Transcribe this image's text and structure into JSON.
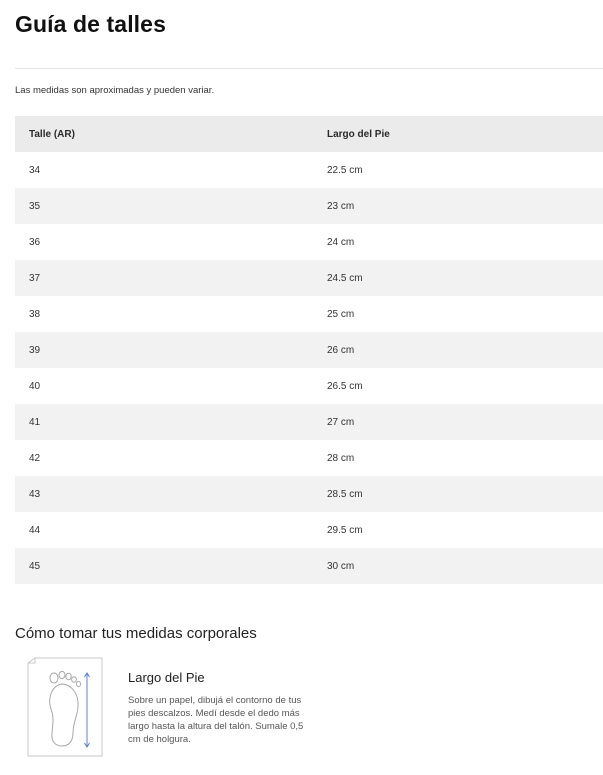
{
  "page": {
    "title": "Guía de talles",
    "disclaimer": "Las medidas son aproximadas y pueden variar."
  },
  "size_table": {
    "headers": {
      "size": "Talle (AR)",
      "foot_length": "Largo del Pie"
    },
    "rows": [
      {
        "size": "34",
        "foot_length": "22.5 cm"
      },
      {
        "size": "35",
        "foot_length": "23 cm"
      },
      {
        "size": "36",
        "foot_length": "24 cm"
      },
      {
        "size": "37",
        "foot_length": "24.5 cm"
      },
      {
        "size": "38",
        "foot_length": "25 cm"
      },
      {
        "size": "39",
        "foot_length": "26 cm"
      },
      {
        "size": "40",
        "foot_length": "26.5 cm"
      },
      {
        "size": "41",
        "foot_length": "27 cm"
      },
      {
        "size": "42",
        "foot_length": "28 cm"
      },
      {
        "size": "43",
        "foot_length": "28.5 cm"
      },
      {
        "size": "44",
        "foot_length": "29.5 cm"
      },
      {
        "size": "45",
        "foot_length": "30 cm"
      }
    ]
  },
  "measurements": {
    "section_title": "Cómo tomar tus medidas corporales",
    "items": [
      {
        "title": "Largo del Pie",
        "description": "Sobre un papel, dibujá el contorno de tus pies descalzos. Medí desde el dedo más largo hasta la altura del talón. Sumale 0,5 cm de holgura.",
        "icon": "foot-measure-icon"
      }
    ]
  },
  "colors": {
    "header_row_bg": "#ebebeb",
    "alt_row_bg": "#f2f2f2",
    "measure_arrow": "#5b7fd6"
  }
}
